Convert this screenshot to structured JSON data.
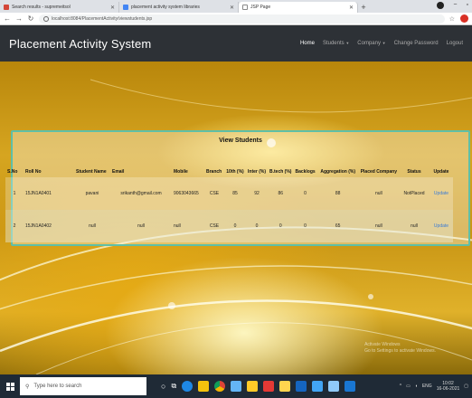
{
  "browser": {
    "tabs": [
      {
        "title": "Search results - supremeitsol",
        "icon_color": "#d44638",
        "active": false
      },
      {
        "title": "placement activity system libraries",
        "icon_color": "#4285f4",
        "active": false
      },
      {
        "title": "JSP Page",
        "icon_color": "#888888",
        "active": true
      }
    ],
    "new_tab": "+",
    "url": "localhost:8084/PlacementActivity/viewstudents.jsp"
  },
  "app": {
    "brand": "Placement Activity System",
    "nav": {
      "home": "Home",
      "students": "Students",
      "company": "Company",
      "change_password": "Change Password",
      "logout": "Logout"
    }
  },
  "panel": {
    "title": "View Students",
    "columns": [
      "S.No",
      "Roll No",
      "Student Name",
      "Email",
      "Mobile",
      "Branch",
      "10th (%)",
      "Inter (%)",
      "B.tech (%)",
      "Backlogs",
      "Aggregation (%)",
      "Placed Company",
      "Status",
      "Update"
    ],
    "rows": [
      {
        "sno": "1",
        "roll": "15JN1A0401",
        "name": "pavani",
        "email": "srikanth@gmail.com",
        "mobile": "9063043665",
        "branch": "CSE",
        "tenth": "85",
        "inter": "92",
        "btech": "86",
        "backlogs": "0",
        "agg": "88",
        "company": "null",
        "status": "NotPlaced",
        "update": "Update"
      },
      {
        "sno": "2",
        "roll": "15JN1A0402",
        "name": "null",
        "email": "null",
        "mobile": "null",
        "branch": "CSE",
        "tenth": "0",
        "inter": "0",
        "btech": "0",
        "backlogs": "0",
        "agg": "65",
        "company": "null",
        "status": "null",
        "update": "Update"
      }
    ]
  },
  "watermark": {
    "line1": "Activate Windows",
    "line2": "Go to Settings to activate Windows."
  },
  "taskbar": {
    "search_placeholder": "Type here to search",
    "icons": [
      "task-view-icon",
      "file-explorer-icon",
      "edge-icon",
      "store-icon",
      "chrome-icon",
      "mail-icon",
      "files-icon",
      "notes-icon",
      "app-icon",
      "app2-icon",
      "app3-icon"
    ],
    "tray_lang": "ENG",
    "time": "10:02",
    "date": "16-06-2021"
  }
}
